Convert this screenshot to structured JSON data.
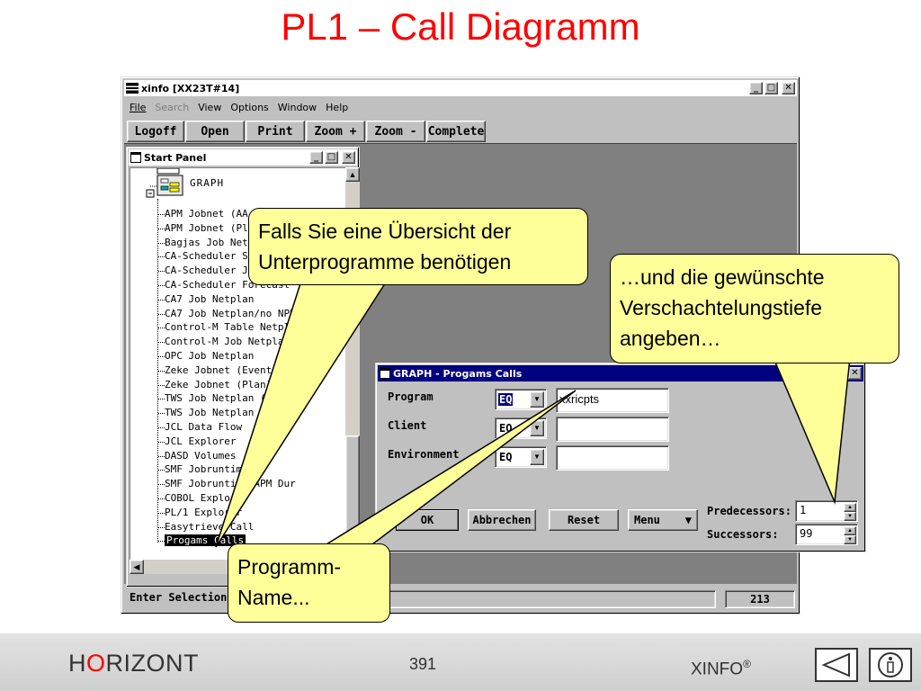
{
  "slide": {
    "title": "PL1 – Call Diagramm"
  },
  "window": {
    "title": "xinfo [XX23T#14]",
    "controls": {
      "minimize": "_",
      "maximize": "□",
      "close": "✕"
    },
    "menu": [
      {
        "label": "File",
        "enabled": true
      },
      {
        "label": "Search",
        "enabled": false
      },
      {
        "label": "View",
        "enabled": true
      },
      {
        "label": "Options",
        "enabled": true
      },
      {
        "label": "Window",
        "enabled": true
      },
      {
        "label": "Help",
        "enabled": true
      }
    ],
    "toolbar": [
      "Logoff",
      "Open",
      "Print",
      "Zoom +",
      "Zoom -",
      "Complete"
    ],
    "status": {
      "text": "Enter Selection",
      "value": "213"
    }
  },
  "start_panel": {
    "title": "Start Panel",
    "root_label": "GRAPH",
    "items": [
      "APM Jobnet (AA",
      "APM Jobnet (Pla",
      "Bagjas Job Netz",
      "CA-Scheduler Sc",
      "CA-Scheduler Jo",
      "CA-Scheduler Forecast",
      "CA7 Job Netplan",
      "CA7 Job Netplan/no NPR",
      "Control-M Table Netpl.",
      "Control-M Job Netplan",
      "OPC Job Netplan",
      "Zeke Jobnet (Events)",
      "Zeke Jobnet (Plan)",
      "TWS Job Netplan (M",
      "TWS Job Netplan (S",
      "JCL Data Flow",
      "JCL Explorer",
      "DASD Volumes",
      "SMF Jobruntim",
      "SMF Jobruntime APM Dur",
      "COBOL Explorer",
      "PL/1 Explorer",
      "Easytrieve Call",
      "Progams Calls"
    ],
    "selected_index": 23
  },
  "dialog": {
    "title": "GRAPH - Progams Calls",
    "fields": [
      {
        "label": "Program",
        "operator": "EQ",
        "value": "xxricpts"
      },
      {
        "label": "Client",
        "operator": "EQ",
        "value": ""
      },
      {
        "label": "Environment",
        "operator": "EQ",
        "value": ""
      }
    ],
    "buttons": {
      "ok": "OK",
      "cancel": "Abbrechen",
      "reset": "Reset",
      "menu": "Menu"
    },
    "predecessors": {
      "label": "Predecessors:",
      "value": "1"
    },
    "successors": {
      "label": "Successors:",
      "value": "99"
    }
  },
  "callouts": {
    "overview": [
      "Falls Sie eine Übersicht der",
      "Unterprogramme benötigen"
    ],
    "depth": [
      "…und die gewünschte",
      "Verschachtelungstiefe",
      "angeben…"
    ],
    "program": [
      "Programm-",
      "Name..."
    ]
  },
  "footer": {
    "brand_h": "H",
    "brand_o": "O",
    "brand_rest": "RIZONT",
    "page": "391",
    "product": "XINFO",
    "product_mark": "®"
  },
  "colors": {
    "title_red": "#ff0000",
    "callout_fill": "#ffff99",
    "dialog_titlebar": "#000080",
    "win_gray": "#c0c0c0",
    "workspace": "#808080"
  }
}
